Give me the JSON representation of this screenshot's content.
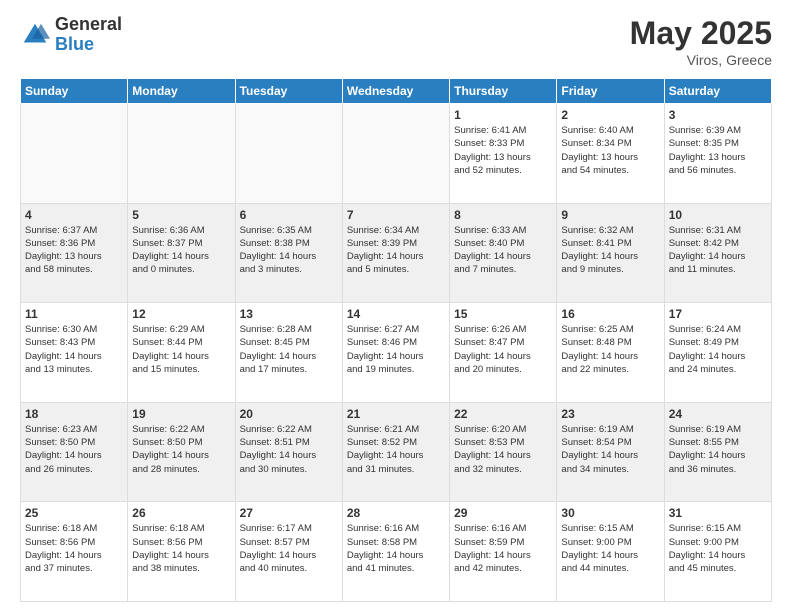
{
  "logo": {
    "general": "General",
    "blue": "Blue"
  },
  "title": {
    "month_year": "May 2025",
    "location": "Viros, Greece"
  },
  "weekdays": [
    "Sunday",
    "Monday",
    "Tuesday",
    "Wednesday",
    "Thursday",
    "Friday",
    "Saturday"
  ],
  "weeks": [
    [
      {
        "day": "",
        "info": ""
      },
      {
        "day": "",
        "info": ""
      },
      {
        "day": "",
        "info": ""
      },
      {
        "day": "",
        "info": ""
      },
      {
        "day": "1",
        "info": "Sunrise: 6:41 AM\nSunset: 8:33 PM\nDaylight: 13 hours\nand 52 minutes."
      },
      {
        "day": "2",
        "info": "Sunrise: 6:40 AM\nSunset: 8:34 PM\nDaylight: 13 hours\nand 54 minutes."
      },
      {
        "day": "3",
        "info": "Sunrise: 6:39 AM\nSunset: 8:35 PM\nDaylight: 13 hours\nand 56 minutes."
      }
    ],
    [
      {
        "day": "4",
        "info": "Sunrise: 6:37 AM\nSunset: 8:36 PM\nDaylight: 13 hours\nand 58 minutes."
      },
      {
        "day": "5",
        "info": "Sunrise: 6:36 AM\nSunset: 8:37 PM\nDaylight: 14 hours\nand 0 minutes."
      },
      {
        "day": "6",
        "info": "Sunrise: 6:35 AM\nSunset: 8:38 PM\nDaylight: 14 hours\nand 3 minutes."
      },
      {
        "day": "7",
        "info": "Sunrise: 6:34 AM\nSunset: 8:39 PM\nDaylight: 14 hours\nand 5 minutes."
      },
      {
        "day": "8",
        "info": "Sunrise: 6:33 AM\nSunset: 8:40 PM\nDaylight: 14 hours\nand 7 minutes."
      },
      {
        "day": "9",
        "info": "Sunrise: 6:32 AM\nSunset: 8:41 PM\nDaylight: 14 hours\nand 9 minutes."
      },
      {
        "day": "10",
        "info": "Sunrise: 6:31 AM\nSunset: 8:42 PM\nDaylight: 14 hours\nand 11 minutes."
      }
    ],
    [
      {
        "day": "11",
        "info": "Sunrise: 6:30 AM\nSunset: 8:43 PM\nDaylight: 14 hours\nand 13 minutes."
      },
      {
        "day": "12",
        "info": "Sunrise: 6:29 AM\nSunset: 8:44 PM\nDaylight: 14 hours\nand 15 minutes."
      },
      {
        "day": "13",
        "info": "Sunrise: 6:28 AM\nSunset: 8:45 PM\nDaylight: 14 hours\nand 17 minutes."
      },
      {
        "day": "14",
        "info": "Sunrise: 6:27 AM\nSunset: 8:46 PM\nDaylight: 14 hours\nand 19 minutes."
      },
      {
        "day": "15",
        "info": "Sunrise: 6:26 AM\nSunset: 8:47 PM\nDaylight: 14 hours\nand 20 minutes."
      },
      {
        "day": "16",
        "info": "Sunrise: 6:25 AM\nSunset: 8:48 PM\nDaylight: 14 hours\nand 22 minutes."
      },
      {
        "day": "17",
        "info": "Sunrise: 6:24 AM\nSunset: 8:49 PM\nDaylight: 14 hours\nand 24 minutes."
      }
    ],
    [
      {
        "day": "18",
        "info": "Sunrise: 6:23 AM\nSunset: 8:50 PM\nDaylight: 14 hours\nand 26 minutes."
      },
      {
        "day": "19",
        "info": "Sunrise: 6:22 AM\nSunset: 8:50 PM\nDaylight: 14 hours\nand 28 minutes."
      },
      {
        "day": "20",
        "info": "Sunrise: 6:22 AM\nSunset: 8:51 PM\nDaylight: 14 hours\nand 30 minutes."
      },
      {
        "day": "21",
        "info": "Sunrise: 6:21 AM\nSunset: 8:52 PM\nDaylight: 14 hours\nand 31 minutes."
      },
      {
        "day": "22",
        "info": "Sunrise: 6:20 AM\nSunset: 8:53 PM\nDaylight: 14 hours\nand 32 minutes."
      },
      {
        "day": "23",
        "info": "Sunrise: 6:19 AM\nSunset: 8:54 PM\nDaylight: 14 hours\nand 34 minutes."
      },
      {
        "day": "24",
        "info": "Sunrise: 6:19 AM\nSunset: 8:55 PM\nDaylight: 14 hours\nand 36 minutes."
      }
    ],
    [
      {
        "day": "25",
        "info": "Sunrise: 6:18 AM\nSunset: 8:56 PM\nDaylight: 14 hours\nand 37 minutes."
      },
      {
        "day": "26",
        "info": "Sunrise: 6:18 AM\nSunset: 8:56 PM\nDaylight: 14 hours\nand 38 minutes."
      },
      {
        "day": "27",
        "info": "Sunrise: 6:17 AM\nSunset: 8:57 PM\nDaylight: 14 hours\nand 40 minutes."
      },
      {
        "day": "28",
        "info": "Sunrise: 6:16 AM\nSunset: 8:58 PM\nDaylight: 14 hours\nand 41 minutes."
      },
      {
        "day": "29",
        "info": "Sunrise: 6:16 AM\nSunset: 8:59 PM\nDaylight: 14 hours\nand 42 minutes."
      },
      {
        "day": "30",
        "info": "Sunrise: 6:15 AM\nSunset: 9:00 PM\nDaylight: 14 hours\nand 44 minutes."
      },
      {
        "day": "31",
        "info": "Sunrise: 6:15 AM\nSunset: 9:00 PM\nDaylight: 14 hours\nand 45 minutes."
      }
    ]
  ]
}
